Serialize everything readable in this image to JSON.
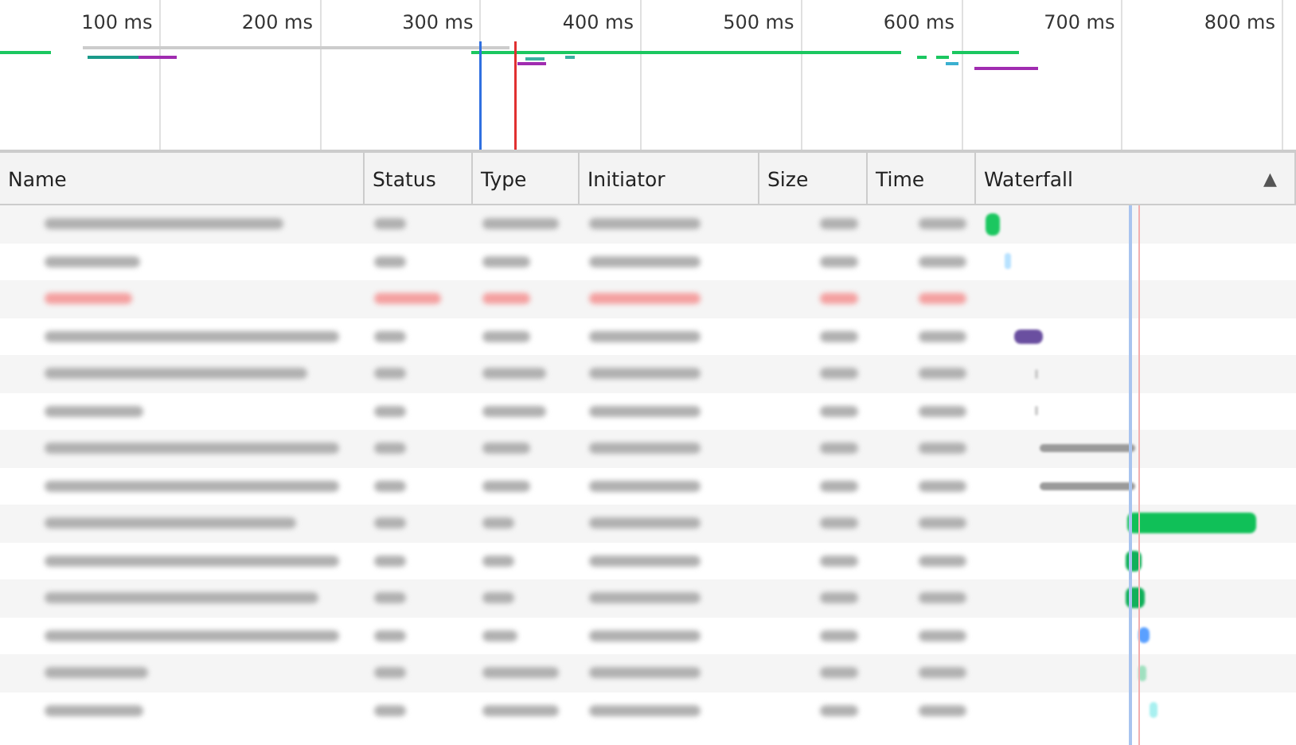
{
  "overview": {
    "ticks": [
      "100 ms",
      "200 ms",
      "300 ms",
      "400 ms",
      "500 ms",
      "600 ms",
      "700 ms",
      "800 ms"
    ]
  },
  "table": {
    "sort_indicator": "▲",
    "columns": [
      {
        "label": "Name",
        "sorted": false
      },
      {
        "label": "Status",
        "sorted": false
      },
      {
        "label": "Type",
        "sorted": false
      },
      {
        "label": "Initiator",
        "sorted": false
      },
      {
        "label": "Size",
        "sorted": false
      },
      {
        "label": "Time",
        "sorted": false
      },
      {
        "label": "Waterfall",
        "sorted": true
      }
    ],
    "rows": [
      {
        "failed": false
      },
      {
        "failed": false
      },
      {
        "failed": true
      },
      {
        "failed": false
      },
      {
        "failed": false
      },
      {
        "failed": false
      },
      {
        "failed": false
      },
      {
        "failed": false
      },
      {
        "failed": false
      },
      {
        "failed": false
      },
      {
        "failed": false
      },
      {
        "failed": false
      },
      {
        "failed": false
      },
      {
        "failed": false
      }
    ]
  }
}
